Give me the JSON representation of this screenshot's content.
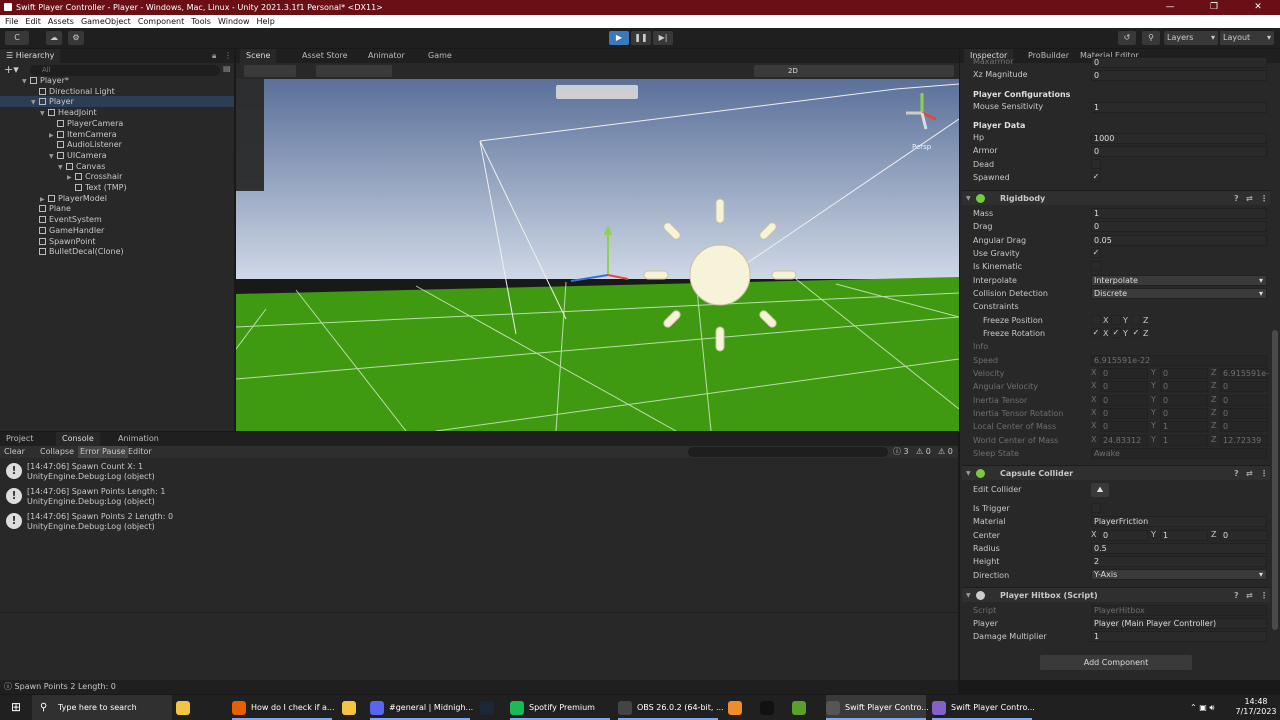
{
  "window": {
    "title": "Swift Player Controller - Player - Windows, Mac, Linux - Unity 2021.3.1f1 Personal* <DX11>"
  },
  "menu": [
    "File",
    "Edit",
    "Assets",
    "GameObject",
    "Component",
    "Tools",
    "Window",
    "Help"
  ],
  "toolbar": {
    "account_label": "C",
    "layers_label": "Layers",
    "layout_label": "Layout"
  },
  "hierarchy": {
    "tab": "Hierarchy",
    "search_placeholder": "All",
    "items": [
      {
        "label": "Player*",
        "depth": 0,
        "fold": "open",
        "icon": "unity-logo-icon"
      },
      {
        "label": "Directional Light",
        "depth": 1,
        "fold": "none"
      },
      {
        "label": "Player",
        "depth": 1,
        "fold": "open",
        "selected": true
      },
      {
        "label": "HeadJoint",
        "depth": 2,
        "fold": "open"
      },
      {
        "label": "PlayerCamera",
        "depth": 3,
        "fold": "none"
      },
      {
        "label": "ItemCamera",
        "depth": 3,
        "fold": "closed"
      },
      {
        "label": "AudioListener",
        "depth": 3,
        "fold": "none"
      },
      {
        "label": "UICamera",
        "depth": 3,
        "fold": "open"
      },
      {
        "label": "Canvas",
        "depth": 4,
        "fold": "open"
      },
      {
        "label": "Crosshair",
        "depth": 5,
        "fold": "closed"
      },
      {
        "label": "Text (TMP)",
        "depth": 5,
        "fold": "none"
      },
      {
        "label": "PlayerModel",
        "depth": 2,
        "fold": "closed"
      },
      {
        "label": "Plane",
        "depth": 1,
        "fold": "none"
      },
      {
        "label": "EventSystem",
        "depth": 1,
        "fold": "none"
      },
      {
        "label": "GameHandler",
        "depth": 1,
        "fold": "none"
      },
      {
        "label": "SpawnPoint",
        "depth": 1,
        "fold": "none"
      },
      {
        "label": "BulletDecal(Clone)",
        "depth": 1,
        "fold": "none"
      }
    ]
  },
  "scene_tabs": [
    "Scene",
    "Asset Store",
    "Animator",
    "Game"
  ],
  "scene": {
    "view_2d_label": "2D",
    "gizmo_label": "Persp"
  },
  "bottom_tabs": [
    "Project",
    "Console",
    "Animation"
  ],
  "console": {
    "buttons": [
      "Clear",
      "Collapse",
      "Error Pause",
      "Editor"
    ],
    "counts": {
      "info": "3",
      "warn": "0",
      "error": "0"
    },
    "logs": [
      {
        "line1": "[14:47:06] Spawn Count X: 1",
        "line2": "UnityEngine.Debug:Log (object)"
      },
      {
        "line1": "[14:47:06] Spawn Points Length: 1",
        "line2": "UnityEngine.Debug:Log (object)"
      },
      {
        "line1": "[14:47:06] Spawn Points 2 Length: 0",
        "line2": "UnityEngine.Debug:Log (object)"
      }
    ],
    "status": "Spawn Points 2 Length: 0"
  },
  "inspector": {
    "tabs": [
      "Inspector",
      "ProBuilder",
      "Material Editor"
    ],
    "top": {
      "max_armor_label": "Maxarmor",
      "max_armor": "0",
      "xz_label": "Xz Magnitude",
      "xz": "0"
    },
    "player_config": {
      "header": "Player Configurations",
      "mouse_label": "Mouse Sensitivity",
      "mouse": "1"
    },
    "player_data": {
      "header": "Player Data",
      "hp_label": "Hp",
      "hp": "1000",
      "armor_label": "Armor",
      "armor": "0",
      "dead_label": "Dead",
      "spawned_label": "Spawned"
    },
    "rigidbody": {
      "title": "Rigidbody",
      "mass_label": "Mass",
      "mass": "1",
      "drag_label": "Drag",
      "drag": "0",
      "angular_drag_label": "Angular Drag",
      "angular_drag": "0.05",
      "use_gravity_label": "Use Gravity",
      "is_kinematic_label": "Is Kinematic",
      "interpolate_label": "Interpolate",
      "interpolate": "Interpolate",
      "collision_label": "Collision Detection",
      "collision": "Discrete",
      "constraints_label": "Constraints",
      "freeze_pos_label": "Freeze Position",
      "freeze_rot_label": "Freeze Rotation",
      "info_label": "Info",
      "speed_label": "Speed",
      "speed": "6.915591e-22",
      "velocity_label": "Velocity",
      "velocity": [
        "0",
        "0",
        "6.915591e-"
      ],
      "ang_vel_label": "Angular Velocity",
      "ang_vel": [
        "0",
        "0",
        "0"
      ],
      "inertia_label": "Inertia Tensor",
      "inertia": [
        "0",
        "0",
        "0"
      ],
      "inertia_rot_label": "Inertia Tensor Rotation",
      "inertia_rot": [
        "0",
        "0",
        "0"
      ],
      "local_com_label": "Local Center of Mass",
      "local_com": [
        "0",
        "1",
        "0"
      ],
      "world_com_label": "World Center of Mass",
      "world_com": [
        "24.83312",
        "1",
        "12.72339"
      ],
      "sleep_label": "Sleep State",
      "sleep": "Awake",
      "axes": [
        "X",
        "Y",
        "Z"
      ]
    },
    "capsule": {
      "title": "Capsule Collider",
      "edit_label": "Edit Collider",
      "trigger_label": "Is Trigger",
      "material_label": "Material",
      "material": "PlayerFriction",
      "center_label": "Center",
      "center": [
        "0",
        "1",
        "0"
      ],
      "radius_label": "Radius",
      "radius": "0.5",
      "height_label": "Height",
      "height": "2",
      "direction_label": "Direction",
      "direction": "Y-Axis"
    },
    "hitbox": {
      "title": "Player Hitbox (Script)",
      "script_label": "Script",
      "script": "PlayerHitbox",
      "player_label": "Player",
      "player": "Player (Main Player Controller)",
      "damage_label": "Damage Multiplier",
      "damage": "1"
    },
    "add_component": "Add Component"
  },
  "taskbar": {
    "search_placeholder": "Type here to search",
    "apps": [
      {
        "label": "How do I check if a...",
        "color": "#e66000"
      },
      {
        "label": "#general | Midnigh...",
        "color": "#5865f2"
      },
      {
        "label": "Spotify Premium",
        "color": "#1db954"
      },
      {
        "label": "OBS 26.0.2 (64-bit, ...",
        "color": "#444444"
      },
      {
        "label": "Swift Player Contro...",
        "color": "#555555"
      },
      {
        "label": "Swift Player Contro...",
        "color": "#8661c5"
      }
    ],
    "time": "14:48",
    "date": "7/17/2023"
  },
  "colors": {
    "title_bar": "#6a0f16",
    "grass": "#3f9a12",
    "sky_top": "#5a7099",
    "sky_bottom": "#cfd8e6",
    "selection": "#2c3e55"
  }
}
